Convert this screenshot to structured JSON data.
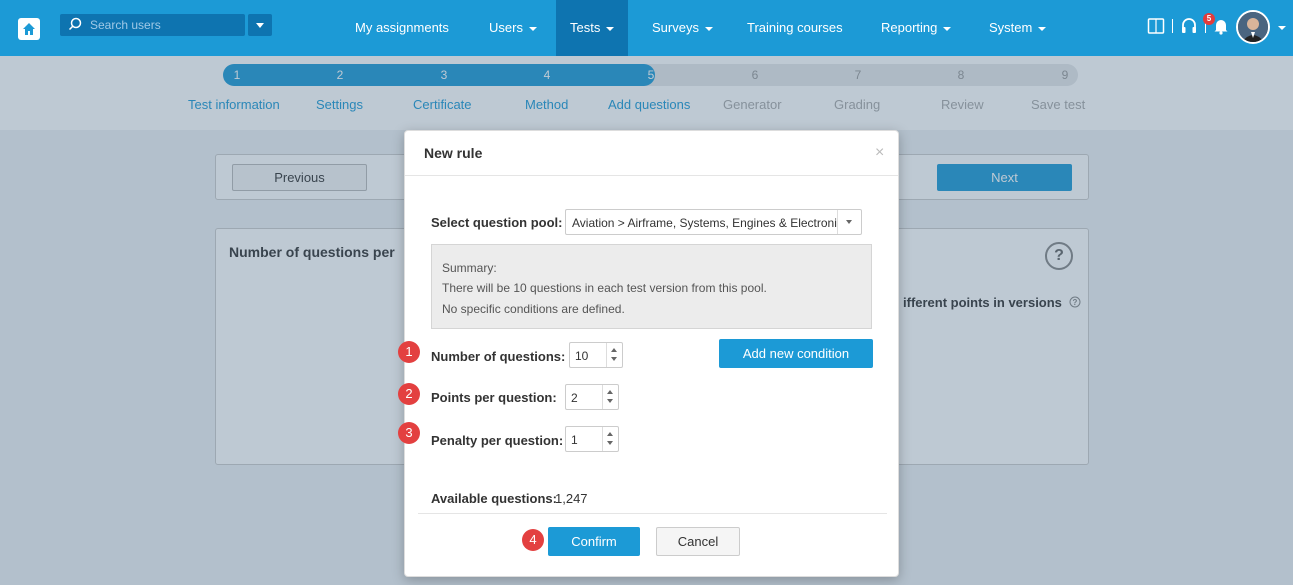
{
  "topbar": {
    "search_placeholder": "Search users",
    "nav": [
      {
        "label": "My assignments",
        "caret": false
      },
      {
        "label": "Users",
        "caret": true
      },
      {
        "label": "Tests",
        "caret": true,
        "active": true
      },
      {
        "label": "Surveys",
        "caret": true
      },
      {
        "label": "Training courses",
        "caret": false
      },
      {
        "label": "Reporting",
        "caret": true
      },
      {
        "label": "System",
        "caret": true
      }
    ],
    "notification_count": "5"
  },
  "steps": [
    {
      "num": "1",
      "label": "Test information",
      "active": true
    },
    {
      "num": "2",
      "label": "Settings",
      "active": true
    },
    {
      "num": "3",
      "label": "Certificate",
      "active": true
    },
    {
      "num": "4",
      "label": "Method",
      "active": true
    },
    {
      "num": "5",
      "label": "Add questions",
      "active": true
    },
    {
      "num": "6",
      "label": "Generator",
      "active": false
    },
    {
      "num": "7",
      "label": "Grading",
      "active": false
    },
    {
      "num": "8",
      "label": "Review",
      "active": false
    },
    {
      "num": "9",
      "label": "Save test",
      "active": false
    }
  ],
  "page": {
    "previous_label": "Previous",
    "next_label": "Next",
    "section_title": "Number of questions per",
    "diff_points_text": "ifferent points in versions",
    "help_label": "?"
  },
  "modal": {
    "title": "New rule",
    "close_glyph": "×",
    "pool_label": "Select question pool:",
    "pool_value": "Aviation > Airframe, Systems, Engines & Electronics",
    "summary": {
      "heading": "Summary:",
      "line1": "There will be 10 questions in each test version from this pool.",
      "line2": "No specific conditions are defined."
    },
    "num_questions_label": "Number of questions:",
    "num_questions_value": "10",
    "points_label": "Points per question:",
    "points_value": "2",
    "penalty_label": "Penalty per question:",
    "penalty_value": "1",
    "add_condition_label": "Add new condition",
    "available_label": "Available questions:",
    "available_value": "1,247",
    "confirm_label": "Confirm",
    "cancel_label": "Cancel"
  },
  "markers": [
    "1",
    "2",
    "3",
    "4"
  ],
  "colors": {
    "brand": "#1c9ad6",
    "brand_dark": "#0e74b0",
    "marker": "#e34040"
  }
}
